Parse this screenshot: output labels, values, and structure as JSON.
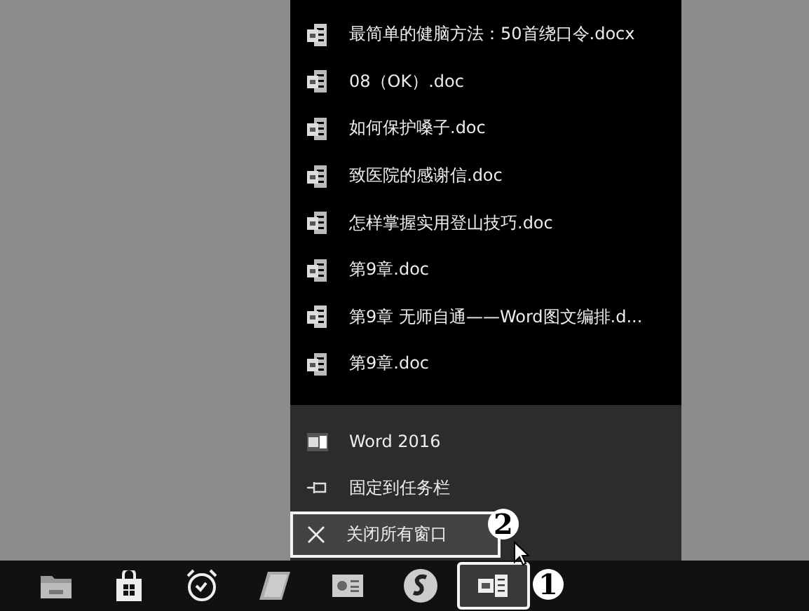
{
  "jump_list": {
    "recent_files": [
      {
        "name": "最简单的健脑方法：50首绕口令.docx",
        "kind": "docx"
      },
      {
        "name": "08（OK）.doc",
        "kind": "doc"
      },
      {
        "name": "如何保护嗓子.doc",
        "kind": "doc"
      },
      {
        "name": "致医院的感谢信.doc",
        "kind": "doc"
      },
      {
        "name": "怎样掌握实用登山技巧.doc",
        "kind": "doc"
      },
      {
        "name": "第9章.doc",
        "kind": "doc"
      },
      {
        "name": "第9章 无师自通——Word图文编排.d...",
        "kind": "docx"
      },
      {
        "name": "第9章.doc",
        "kind": "doc"
      }
    ],
    "actions": [
      {
        "label": "Word 2016",
        "kind": "app",
        "selected": false
      },
      {
        "label": "固定到任务栏",
        "kind": "pin",
        "selected": false
      },
      {
        "label": "关闭所有窗口",
        "kind": "close",
        "selected": true
      }
    ]
  },
  "taskbar": {
    "apps": [
      {
        "kind": "folder",
        "active": false
      },
      {
        "kind": "store",
        "active": false
      },
      {
        "kind": "clock",
        "active": false
      },
      {
        "kind": "notes",
        "active": false
      },
      {
        "kind": "slides",
        "active": false
      },
      {
        "kind": "s-app",
        "active": false
      },
      {
        "kind": "word",
        "active": true
      }
    ]
  },
  "callouts": [
    "1",
    "2"
  ]
}
